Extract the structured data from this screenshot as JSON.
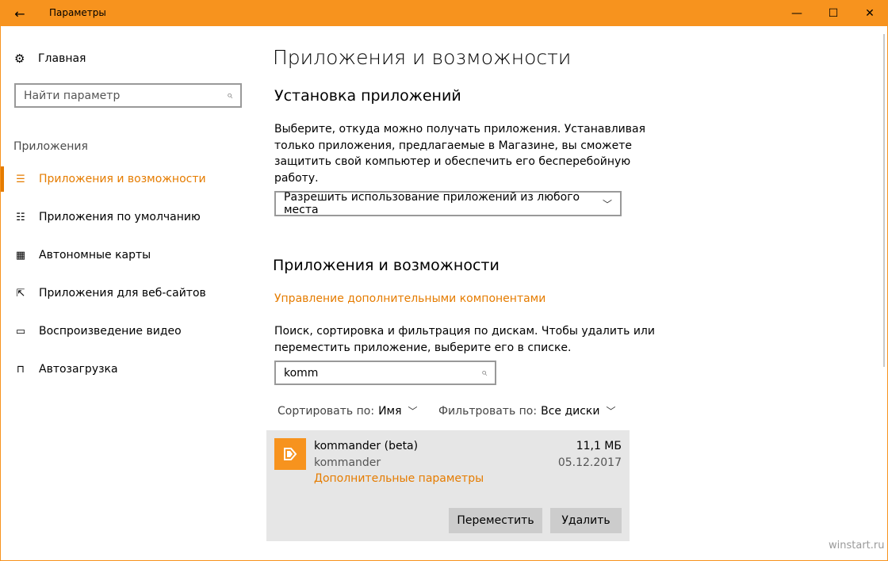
{
  "window": {
    "title": "Параметры",
    "accent": "#f7931e"
  },
  "titlebar": {
    "back_icon": "←",
    "minimize_icon": "—",
    "maximize_icon": "☐",
    "close_icon": "✕"
  },
  "sidebar": {
    "home_label": "Главная",
    "home_icon": "⚙",
    "search_placeholder": "Найти параметр",
    "section": "Приложения",
    "items": [
      {
        "label": "Приложения и возможности",
        "icon": "☰",
        "active": true
      },
      {
        "label": "Приложения по умолчанию",
        "icon": "☷",
        "active": false
      },
      {
        "label": "Автономные карты",
        "icon": "▦",
        "active": false
      },
      {
        "label": "Приложения для веб-сайтов",
        "icon": "⇱",
        "active": false
      },
      {
        "label": "Воспроизведение видео",
        "icon": "▭",
        "active": false
      },
      {
        "label": "Автозагрузка",
        "icon": "⊓",
        "active": false
      }
    ]
  },
  "main": {
    "title": "Приложения и возможности",
    "install_heading": "Установка приложений",
    "install_lines": [
      "Выберите, откуда можно получать приложения. Устанавливая",
      "только приложения, предлагаемые в Магазине, вы сможете",
      "защитить свой компьютер и обеспечить его бесперебойную",
      "работу."
    ],
    "install_dropdown": "Разрешить использование приложений из любого места",
    "apps_heading": "Приложения и возможности",
    "manage_link": "Управление дополнительными компонентами",
    "search_lines": [
      "Поиск, сортировка и фильтрация по дискам. Чтобы удалить или",
      "переместить приложение, выберите его в списке."
    ],
    "search_value": "komm",
    "sort_label": "Сортировать по:",
    "sort_value": "Имя",
    "filter_label": "Фильтровать по:",
    "filter_value": "Все диски",
    "app": {
      "name": "kommander (beta)",
      "publisher": "kommander",
      "advanced_link": "Дополнительные параметры",
      "size": "11,1 МБ",
      "date": "05.12.2017",
      "move_button": "Переместить",
      "uninstall_button": "Удалить"
    }
  },
  "watermark": "winstart.ru"
}
